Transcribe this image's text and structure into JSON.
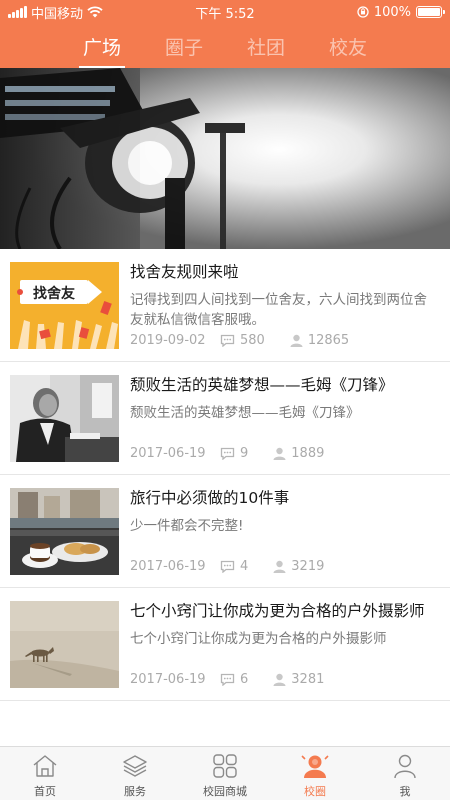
{
  "status_bar": {
    "carrier": "中国移动",
    "time": "下午 5:52",
    "battery": "100%",
    "battery_level": 1.0
  },
  "top_tabs": [
    {
      "label": "广场",
      "active": true
    },
    {
      "label": "圈子",
      "active": false
    },
    {
      "label": "社团",
      "active": false
    },
    {
      "label": "校友",
      "active": false
    }
  ],
  "articles": [
    {
      "title": "找舍友规则来啦",
      "summary": "记得找到四人间找到一位舍友，六人间找到两位舍友就私信微信客服哦。",
      "date": "2019-09-02",
      "comments": "580",
      "views": "12865",
      "thumb_text": "找舍友"
    },
    {
      "title": "颓败生活的英雄梦想——毛姆《刀锋》",
      "summary": "颓败生活的英雄梦想——毛姆《刀锋》",
      "date": "2017-06-19",
      "comments": "9",
      "views": "1889"
    },
    {
      "title": "旅行中必须做的10件事",
      "summary": "少一件都会不完整!",
      "date": "2017-06-19",
      "comments": "4",
      "views": "3219"
    },
    {
      "title": "七个小窍门让你成为更为合格的户外摄影师",
      "summary": "七个小窍门让你成为更为合格的户外摄影师",
      "date": "2017-06-19",
      "comments": "6",
      "views": "3281"
    }
  ],
  "bottom_nav": [
    {
      "label": "首页",
      "icon": "home-icon",
      "active": false
    },
    {
      "label": "服务",
      "icon": "layers-icon",
      "active": false
    },
    {
      "label": "校园商城",
      "icon": "grid-icon",
      "active": false
    },
    {
      "label": "校圈",
      "icon": "campus-circle-icon",
      "active": true
    },
    {
      "label": "我",
      "icon": "user-icon",
      "active": false
    }
  ],
  "colors": {
    "accent": "#f47b4f",
    "meta_text": "#aaaaaa",
    "nav_inactive": "#555555"
  }
}
